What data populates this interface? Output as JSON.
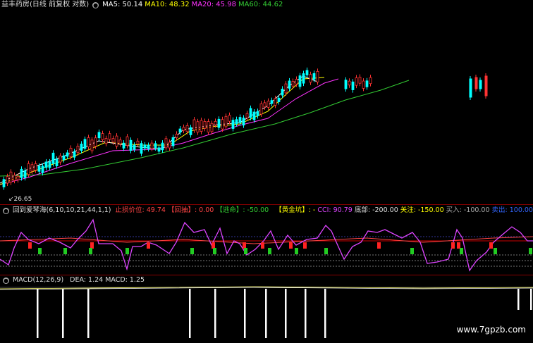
{
  "price_panel": {
    "title": "益丰药房(日线 前复权 对数)",
    "ma5_label": "MA5: 50.14",
    "ma10_label": "MA10: 48.32",
    "ma20_label": "MA20: 45.98",
    "ma60_label": "MA60: 44.62",
    "low_price_label": "26.65",
    "low_marker": "↙",
    "colors": {
      "ma5": "#ffffff",
      "ma10": "#ffff00",
      "ma20": "#ff33ff",
      "ma60": "#33cc33",
      "up": "#ff3333",
      "down": "#00ffff"
    }
  },
  "indicator_panel": {
    "name": "回到爱琴海(6,10,10,21,44,1,1)",
    "stop_loss": "止损价位: 49.74",
    "pullback": "【回抽】: 0.00",
    "escape": "【逃命】: -50.00",
    "golden_pit": "【黄金坑】: -",
    "cci": "CCI: 90.79",
    "bottom": "底部: -200.00",
    "attention": "关注: -150.00",
    "buy": "买入: -100.00",
    "sell": "卖出: 100.00",
    "colors": {
      "cci_line": "#dd44ff",
      "red_bar": "#ff2222",
      "green_bar": "#22cc22",
      "blue": "#3366ff"
    }
  },
  "macd_panel": {
    "name": "MACD(12,26,9)",
    "dea": "DEA: 1.24",
    "macd": "MACD: 1.25"
  },
  "watermark": "www.7gpzb.com"
}
